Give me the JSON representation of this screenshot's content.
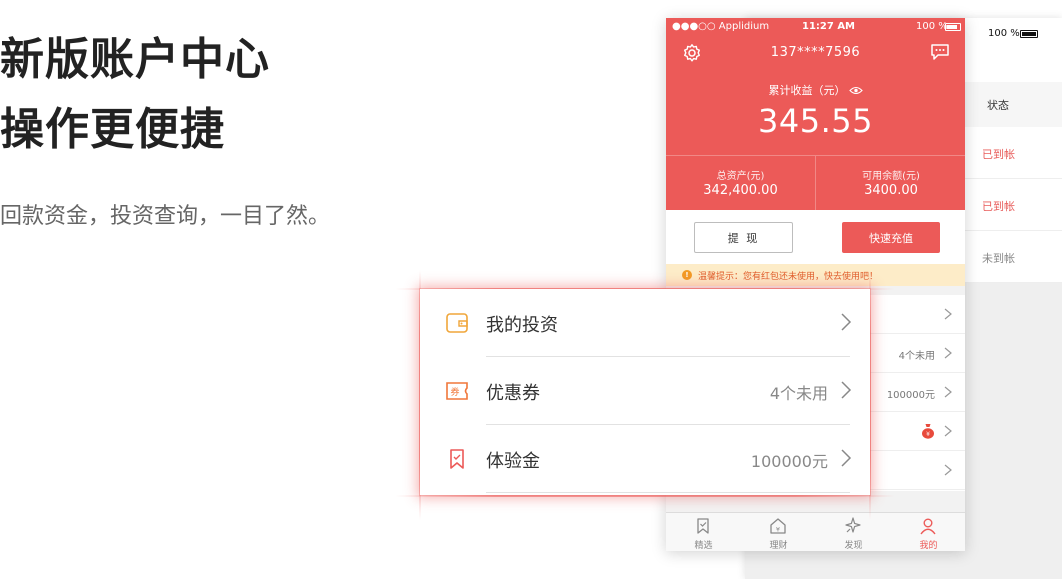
{
  "hero": {
    "title_line1": "新版账户中心",
    "title_line2": "操作更便捷",
    "subtitle": "回款资金，投资查询，一目了然。"
  },
  "back_screen": {
    "battery": "100 %",
    "column_header": "状态",
    "rows": [
      {
        "status": "已到帐"
      },
      {
        "status": "已到帐"
      },
      {
        "status": "未到帐"
      }
    ]
  },
  "phone": {
    "status_bar": {
      "carrier": "●●●○○ Applidium",
      "time": "11:27 AM",
      "battery": "100 %"
    },
    "phone_number": "137****7596",
    "income_label": "累计收益（元）",
    "income": "345.55",
    "total_assets": {
      "label": "总资产(元)",
      "value": "342,400.00"
    },
    "available_balance": {
      "label": "可用余额(元)",
      "value": "3400.00"
    },
    "withdraw_label": "提 现",
    "recharge_label": "快速充值",
    "tip_icon": "!",
    "tip": "温馨提示：您有红包还未使用，快去使用吧！",
    "list": [
      {
        "value": ""
      },
      {
        "value": "4个未用"
      },
      {
        "value": "100000元"
      },
      {
        "value": ""
      },
      {
        "value": ""
      }
    ],
    "tabs": [
      {
        "label": "精选"
      },
      {
        "label": "理财"
      },
      {
        "label": "发现"
      },
      {
        "label": "我的"
      }
    ]
  },
  "zoom": {
    "rows": [
      {
        "label": "我的投资",
        "value": ""
      },
      {
        "label": "优惠券",
        "value": "4个未用"
      },
      {
        "label": "体验金",
        "value": "100000元"
      }
    ]
  },
  "colors": {
    "accent": "#ec5a58",
    "tip_bg": "#fdecc8",
    "orange": "#f29a25"
  },
  "icons": {
    "settings": "gear-icon",
    "messages": "chat-icon",
    "visibility": "eye-icon",
    "investment": "wallet-icon",
    "coupon": "coupon-icon",
    "trial": "bookmark-icon",
    "tabs": [
      "bookmark-icon",
      "house-icon",
      "sparkle-icon",
      "person-icon"
    ]
  }
}
